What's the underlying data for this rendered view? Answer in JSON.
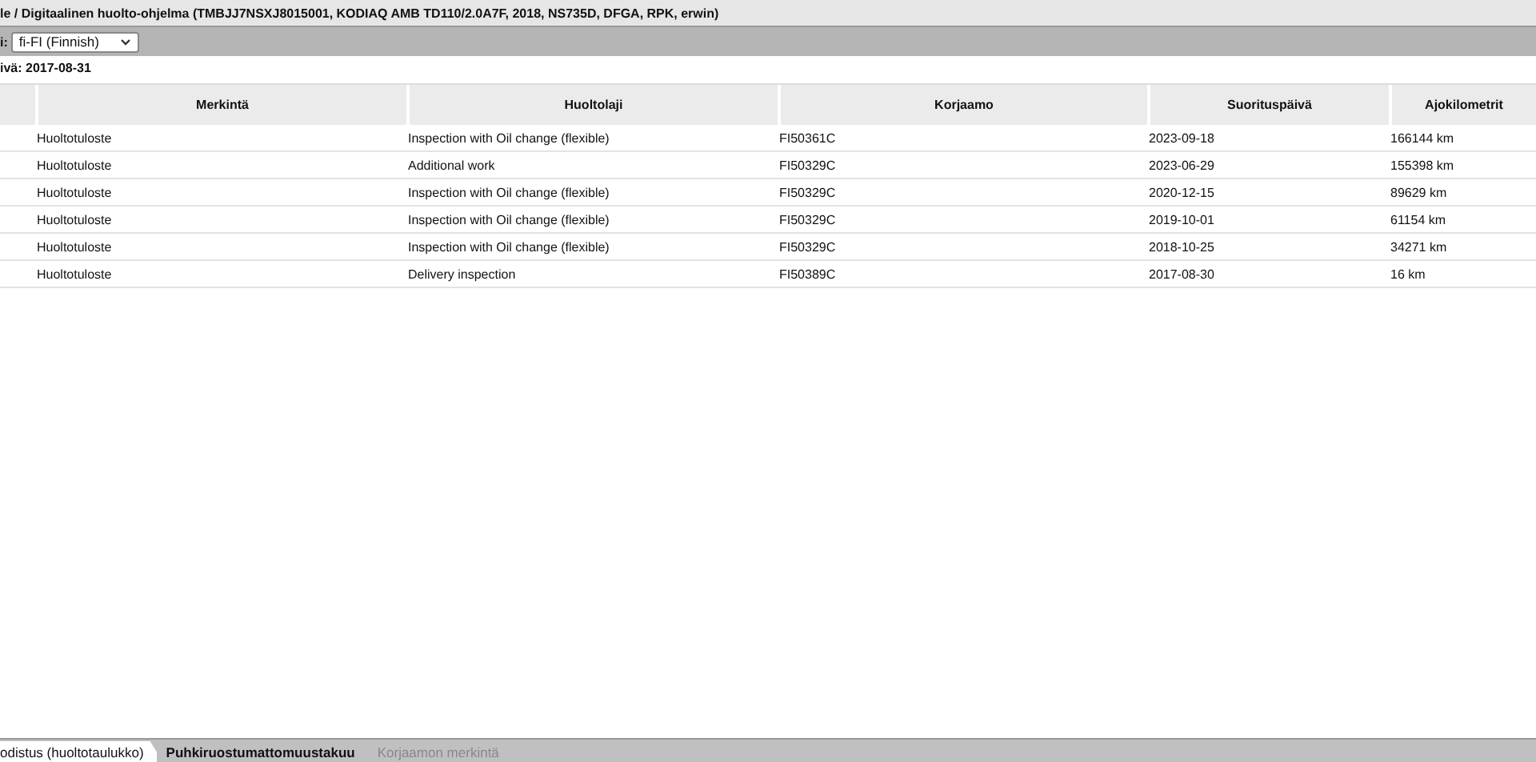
{
  "window": {
    "title": "le / Digitaalinen huolto-ohjelma (TMBJJ7NSXJ8015001, KODIAQ AMB TD110/2.0A7F, 2018, NS735D, DFGA, RPK, erwin)"
  },
  "toolbar": {
    "label": "i:",
    "language": "fi-FI (Finnish)"
  },
  "date_line": "ivä: 2017-08-31",
  "table": {
    "columns": [
      "Merkintä",
      "Huoltolaji",
      "Korjaamo",
      "Suorituspäivä",
      "Ajokilometrit"
    ],
    "rows": [
      [
        "Huoltotuloste",
        "Inspection with Oil change (flexible)",
        "FI50361C",
        "2023-09-18",
        "166144 km"
      ],
      [
        "Huoltotuloste",
        "Additional work",
        "FI50329C",
        "2023-06-29",
        "155398 km"
      ],
      [
        "Huoltotuloste",
        "Inspection with Oil change (flexible)",
        "FI50329C",
        "2020-12-15",
        "89629 km"
      ],
      [
        "Huoltotuloste",
        "Inspection with Oil change (flexible)",
        "FI50329C",
        "2019-10-01",
        "61154 km"
      ],
      [
        "Huoltotuloste",
        "Inspection with Oil change (flexible)",
        "FI50329C",
        "2018-10-25",
        "34271 km"
      ],
      [
        "Huoltotuloste",
        "Delivery inspection",
        "FI50389C",
        "2017-08-30",
        "16 km"
      ]
    ]
  },
  "tabs": [
    {
      "label": "odistus (huoltotaulukko)",
      "selected": true,
      "disabled": false
    },
    {
      "label": "Puhkiruostumattomuustakuu",
      "selected": false,
      "disabled": false
    },
    {
      "label": "Korjaamon merkintä",
      "selected": false,
      "disabled": true
    }
  ]
}
